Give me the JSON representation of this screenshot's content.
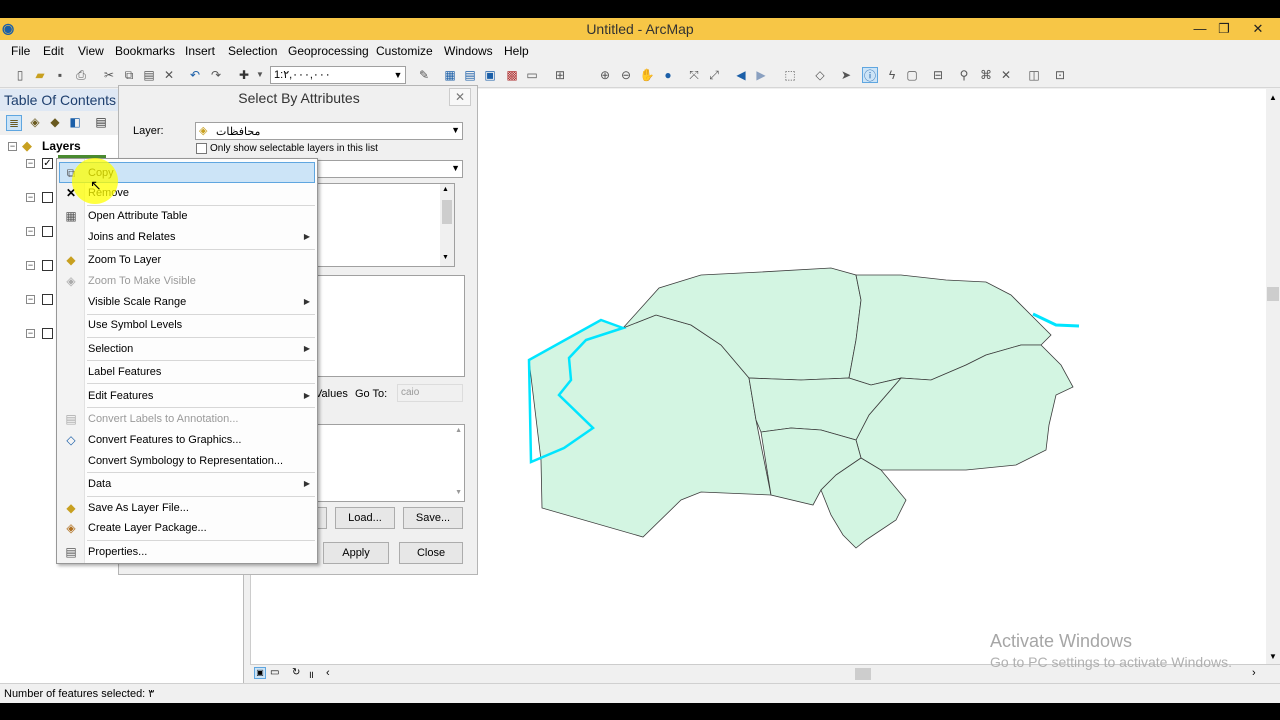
{
  "window": {
    "title": "Untitled - ArcMap"
  },
  "menu": [
    "File",
    "Edit",
    "View",
    "Bookmarks",
    "Insert",
    "Selection",
    "Geoprocessing",
    "Customize",
    "Windows",
    "Help"
  ],
  "toolbar": {
    "scale": "1:٢,٠٠٠,٠٠٠"
  },
  "toc": {
    "title": "Table Of Contents",
    "root": "Layers"
  },
  "dialog": {
    "title": "Select By Attributes",
    "layer_label": "Layer:",
    "layer_value": "محافظات",
    "only_selectable": "Only show selectable layers in this list",
    "values_btn": "Values",
    "goto_label": "Go To:",
    "goto_value": "caio",
    "load": "Load...",
    "save": "Save...",
    "apply": "Apply",
    "close": "Close"
  },
  "context_menu": {
    "copy": "Copy",
    "remove": "Remove",
    "open_attr": "Open Attribute Table",
    "joins": "Joins and Relates",
    "zoom_layer": "Zoom To Layer",
    "zoom_visible": "Zoom To Make Visible",
    "scale_range": "Visible Scale Range",
    "symbol_levels": "Use Symbol Levels",
    "selection": "Selection",
    "label_features": "Label Features",
    "edit_features": "Edit Features",
    "convert_labels": "Convert Labels to Annotation...",
    "convert_features": "Convert Features to Graphics...",
    "convert_symbology": "Convert Symbology to Representation...",
    "data": "Data",
    "save_layer": "Save As Layer File...",
    "create_package": "Create Layer Package...",
    "properties": "Properties..."
  },
  "watermark": {
    "line1": "Activate Windows",
    "line2": "Go to PC settings to activate Windows."
  },
  "status": {
    "text": "Number of features selected: ٣"
  },
  "colors": {
    "titlebar": "#f7c646",
    "map_fill": "#d3f5e2",
    "selection": "#00e5ff"
  }
}
